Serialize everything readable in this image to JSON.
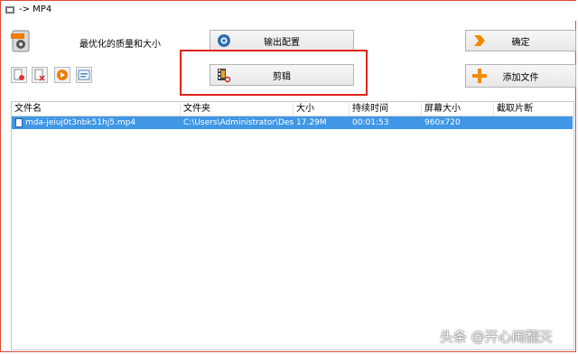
{
  "window": {
    "title": "-> MP4"
  },
  "profile": {
    "label": "最优化的质量和大小"
  },
  "buttons": {
    "output_config": "输出配置",
    "cut": "剪辑",
    "ok": "确定",
    "add_file": "添加文件"
  },
  "toolbar": {
    "icons": [
      "delete-icon",
      "clear-icon",
      "play-icon",
      "media-info-icon"
    ]
  },
  "table": {
    "columns": [
      "文件名",
      "文件夹",
      "大小",
      "持续时间",
      "屏幕大小",
      "截取片断"
    ],
    "rows": [
      {
        "filename": "mda-jeiuj0t3nbk51hj5.mp4",
        "folder": "C:\\Users\\Administrator\\Des...",
        "size": "17.29M",
        "duration": "00:01:53",
        "resolution": "960x720",
        "clip": ""
      }
    ]
  },
  "colors": {
    "highlight_box": "#e2231a",
    "selected_row": "#3f97e6"
  },
  "watermark": {
    "text": "头条 @开心闹翻天"
  }
}
